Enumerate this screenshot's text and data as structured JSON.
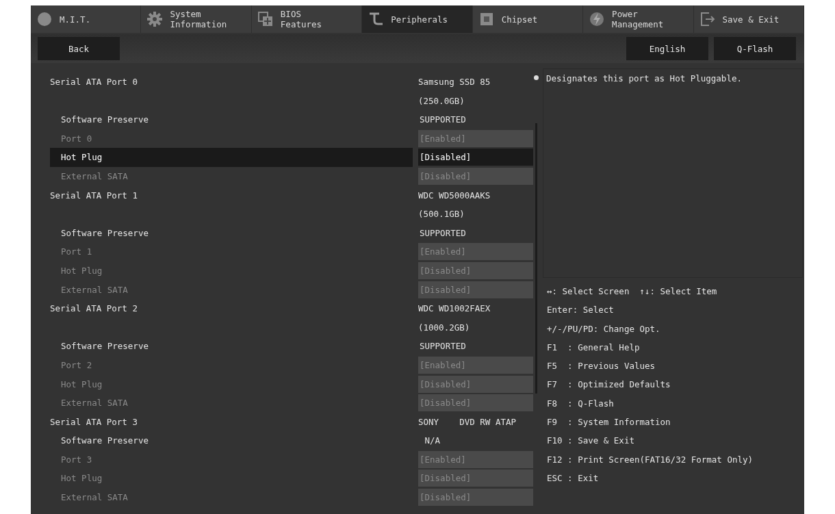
{
  "tabs": [
    {
      "label": "M.I.T.",
      "selected": false
    },
    {
      "label": "System\nInformation",
      "selected": false
    },
    {
      "label": "BIOS\nFeatures",
      "selected": false
    },
    {
      "label": "Peripherals",
      "selected": true
    },
    {
      "label": "Chipset",
      "selected": false
    },
    {
      "label": "Power\nManagement",
      "selected": false
    },
    {
      "label": "Save & Exit",
      "selected": false
    }
  ],
  "toolbar": {
    "left": [
      "Back"
    ],
    "right": [
      "English",
      "Q-Flash"
    ]
  },
  "ports": [
    {
      "label": "Serial ATA Port 0",
      "device": [
        "Samsung SSD 85",
        "(250.0GB)"
      ],
      "settings": [
        {
          "label": "Software Preserve",
          "value": "SUPPORTED",
          "kind": "info",
          "disabled": false,
          "selected": false
        },
        {
          "label": "Port 0",
          "value": "[Enabled]",
          "kind": "option",
          "disabled": true,
          "selected": false
        },
        {
          "label": "Hot Plug",
          "value": "[Disabled]",
          "kind": "option",
          "disabled": false,
          "selected": true
        },
        {
          "label": "External SATA",
          "value": "[Disabled]",
          "kind": "option",
          "disabled": true,
          "selected": false
        }
      ]
    },
    {
      "label": "Serial ATA Port 1",
      "device": [
        "WDC WD5000AAKS",
        "(500.1GB)"
      ],
      "settings": [
        {
          "label": "Software Preserve",
          "value": "SUPPORTED",
          "kind": "info",
          "disabled": false,
          "selected": false
        },
        {
          "label": "Port 1",
          "value": "[Enabled]",
          "kind": "option",
          "disabled": true,
          "selected": false
        },
        {
          "label": "Hot Plug",
          "value": "[Disabled]",
          "kind": "option",
          "disabled": true,
          "selected": false
        },
        {
          "label": "External SATA",
          "value": "[Disabled]",
          "kind": "option",
          "disabled": true,
          "selected": false
        }
      ]
    },
    {
      "label": "Serial ATA Port 2",
      "device": [
        "WDC WD1002FAEX",
        "(1000.2GB)"
      ],
      "settings": [
        {
          "label": "Software Preserve",
          "value": "SUPPORTED",
          "kind": "info",
          "disabled": false,
          "selected": false
        },
        {
          "label": "Port 2",
          "value": "[Enabled]",
          "kind": "option",
          "disabled": true,
          "selected": false
        },
        {
          "label": "Hot Plug",
          "value": "[Disabled]",
          "kind": "option",
          "disabled": true,
          "selected": false
        },
        {
          "label": "External SATA",
          "value": "[Disabled]",
          "kind": "option",
          "disabled": true,
          "selected": false
        }
      ]
    },
    {
      "label": "Serial ATA Port 3",
      "device": [
        "SONY    DVD RW ATAP"
      ],
      "settings": [
        {
          "label": "Software Preserve",
          "value": " N/A",
          "kind": "info",
          "disabled": false,
          "selected": false
        },
        {
          "label": "Port 3",
          "value": "[Enabled]",
          "kind": "option",
          "disabled": true,
          "selected": false
        },
        {
          "label": "Hot Plug",
          "value": "[Disabled]",
          "kind": "option",
          "disabled": true,
          "selected": false
        },
        {
          "label": "External SATA",
          "value": "[Disabled]",
          "kind": "option",
          "disabled": true,
          "selected": false
        }
      ]
    }
  ],
  "help": "Designates this port as Hot Pluggable.",
  "keys": [
    "↔: Select Screen  ↑↓: Select Item",
    "Enter: Select",
    "+/-/PU/PD: Change Opt.",
    "F1  : General Help",
    "F5  : Previous Values",
    "F7  : Optimized Defaults",
    "F8  : Q-Flash",
    "F9  : System Information",
    "F10 : Save & Exit",
    "F12 : Print Screen(FAT16/32 Format Only)",
    "ESC : Exit"
  ]
}
